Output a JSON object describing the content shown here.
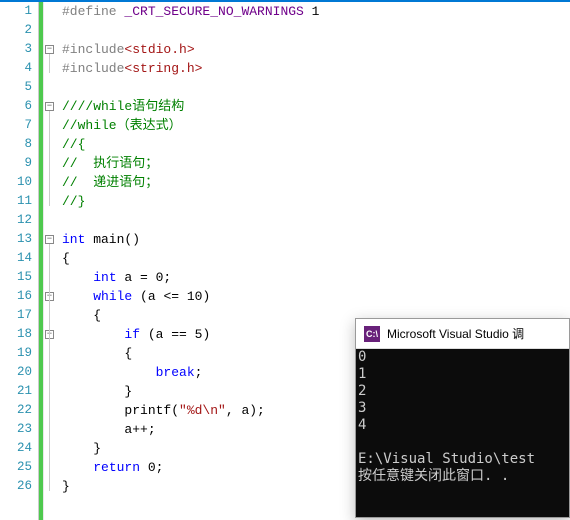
{
  "editor": {
    "lines": [
      {
        "n": 1,
        "seg": [
          {
            "c": "pp",
            "t": "#define "
          },
          {
            "c": "mac",
            "t": "_CRT_SECURE_NO_WARNINGS"
          },
          {
            "c": "txt",
            "t": " 1"
          }
        ]
      },
      {
        "n": 2,
        "seg": []
      },
      {
        "n": 3,
        "fold": "-",
        "seg": [
          {
            "c": "pp",
            "t": "#include"
          },
          {
            "c": "str",
            "t": "<stdio.h>"
          }
        ]
      },
      {
        "n": 4,
        "seg": [
          {
            "c": "pp",
            "t": "#include"
          },
          {
            "c": "str",
            "t": "<string.h>"
          }
        ]
      },
      {
        "n": 5,
        "seg": []
      },
      {
        "n": 6,
        "fold": "-",
        "seg": [
          {
            "c": "cmt",
            "t": "////while语句结构"
          }
        ]
      },
      {
        "n": 7,
        "seg": [
          {
            "c": "cmt",
            "t": "//while（表达式）"
          }
        ]
      },
      {
        "n": 8,
        "seg": [
          {
            "c": "cmt",
            "t": "//{"
          }
        ]
      },
      {
        "n": 9,
        "seg": [
          {
            "c": "cmt",
            "t": "//  执行语句；"
          }
        ]
      },
      {
        "n": 10,
        "seg": [
          {
            "c": "cmt",
            "t": "//  递进语句；"
          }
        ]
      },
      {
        "n": 11,
        "seg": [
          {
            "c": "cmt",
            "t": "//}"
          }
        ]
      },
      {
        "n": 12,
        "seg": []
      },
      {
        "n": 13,
        "fold": "-",
        "seg": [
          {
            "c": "kw",
            "t": "int"
          },
          {
            "c": "txt",
            "t": " main()"
          }
        ]
      },
      {
        "n": 14,
        "seg": [
          {
            "c": "txt",
            "t": "{"
          }
        ]
      },
      {
        "n": 15,
        "indent": 1,
        "seg": [
          {
            "c": "kw",
            "t": "int"
          },
          {
            "c": "txt",
            "t": " a = 0;"
          }
        ]
      },
      {
        "n": 16,
        "fold": "-",
        "indent": 1,
        "seg": [
          {
            "c": "kw",
            "t": "while"
          },
          {
            "c": "txt",
            "t": " (a <= 10)"
          }
        ]
      },
      {
        "n": 17,
        "indent": 1,
        "seg": [
          {
            "c": "txt",
            "t": "{"
          }
        ]
      },
      {
        "n": 18,
        "fold": "-",
        "indent": 2,
        "seg": [
          {
            "c": "kw",
            "t": "if"
          },
          {
            "c": "txt",
            "t": " (a == 5)"
          }
        ]
      },
      {
        "n": 19,
        "indent": 2,
        "seg": [
          {
            "c": "txt",
            "t": "{"
          }
        ]
      },
      {
        "n": 20,
        "indent": 3,
        "seg": [
          {
            "c": "kw",
            "t": "break"
          },
          {
            "c": "txt",
            "t": ";"
          }
        ]
      },
      {
        "n": 21,
        "indent": 2,
        "seg": [
          {
            "c": "txt",
            "t": "}"
          }
        ]
      },
      {
        "n": 22,
        "indent": 2,
        "seg": [
          {
            "c": "txt",
            "t": "printf("
          },
          {
            "c": "str",
            "t": "\"%d\\n\""
          },
          {
            "c": "txt",
            "t": ", a);"
          }
        ]
      },
      {
        "n": 23,
        "indent": 2,
        "seg": [
          {
            "c": "txt",
            "t": "a++;"
          }
        ]
      },
      {
        "n": 24,
        "indent": 1,
        "seg": [
          {
            "c": "txt",
            "t": "}"
          }
        ]
      },
      {
        "n": 25,
        "indent": 1,
        "seg": [
          {
            "c": "kw",
            "t": "return"
          },
          {
            "c": "txt",
            "t": " 0;"
          }
        ]
      },
      {
        "n": 26,
        "seg": [
          {
            "c": "txt",
            "t": "}"
          }
        ]
      }
    ]
  },
  "console": {
    "icon_text": "C:\\",
    "title": "Microsoft Visual Studio 调",
    "output": [
      "0",
      "1",
      "2",
      "3",
      "4",
      "",
      "E:\\Visual Studio\\test",
      "按任意键关闭此窗口. ."
    ]
  }
}
